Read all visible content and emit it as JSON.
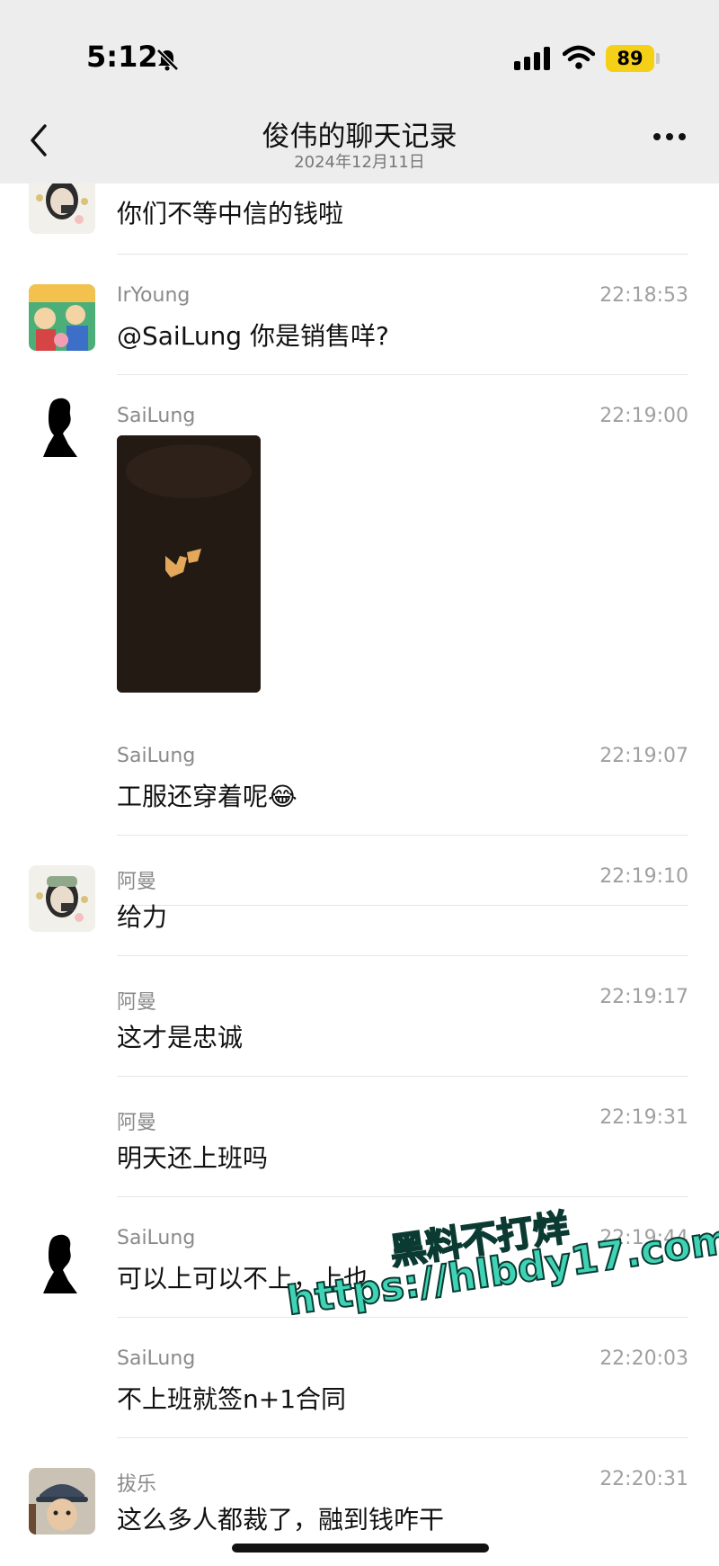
{
  "status_bar": {
    "time": "5:12",
    "battery": "89"
  },
  "nav": {
    "title": "俊伟的聊天记录",
    "subtitle": "2024年12月11日"
  },
  "messages": [
    {
      "sender": "",
      "time": "",
      "text": "你们不等中信的钱啦"
    },
    {
      "sender": "IrYoung",
      "time": "22:18:53",
      "text": "@SaiLung 你是销售咩?"
    },
    {
      "sender": "SaiLung",
      "time": "22:19:00",
      "text": ""
    },
    {
      "sender": "SaiLung",
      "time": "22:19:07",
      "text": "工服还穿着呢",
      "emoji": "😂"
    },
    {
      "sender": "阿曼",
      "time": "22:19:10",
      "text": "给力"
    },
    {
      "sender": "阿曼",
      "time": "22:19:17",
      "text": "这才是忠诚"
    },
    {
      "sender": "阿曼",
      "time": "22:19:31",
      "text": "明天还上班吗"
    },
    {
      "sender": "SaiLung",
      "time": "22:19:44",
      "text": "可以上可以不上，上也"
    },
    {
      "sender": "SaiLung",
      "time": "22:20:03",
      "text": "不上班就签n+1合同"
    },
    {
      "sender": "拔乐",
      "time": "22:20:31",
      "text": "这么多人都裁了，融到钱咋干"
    }
  ],
  "watermark": {
    "line1": "黑料不打烊",
    "line2": "https://hlbdy17.com"
  },
  "colors": {
    "nav_bg": "#ededed",
    "battery": "#f4d017",
    "watermark": "#3fd3b5"
  }
}
